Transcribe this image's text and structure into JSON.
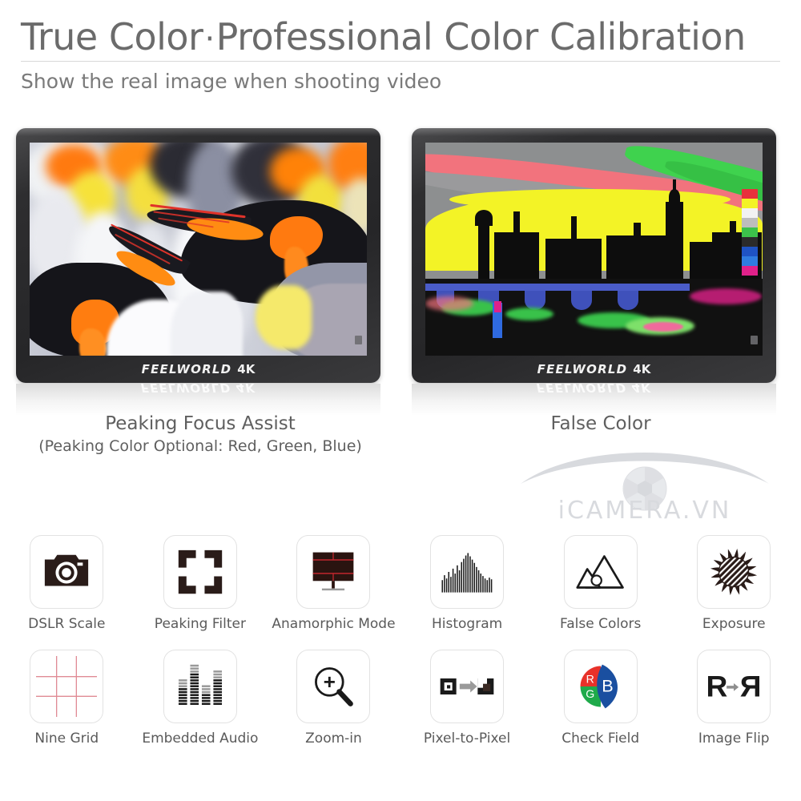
{
  "header": {
    "headline_part1": "True Color",
    "headline_separator": "·",
    "headline_part2": "Professional Color Calibration",
    "subhead": "Show the real image when shooting video"
  },
  "monitors": [
    {
      "brand": "FEELWORLD",
      "model": "4K",
      "screen_content": "king-penguins-with-red-peaking-highlights",
      "caption_title": "Peaking Focus Assist",
      "caption_note": "(Peaking Color Optional: Red, Green, Blue)"
    },
    {
      "brand": "FEELWORLD",
      "model": "4K",
      "screen_content": "westminster-big-ben-false-color",
      "caption_title": "False Color",
      "caption_note": ""
    }
  ],
  "false_color_scale": [
    "#e8313c",
    "#f3f326",
    "#f2f2f2",
    "#bdbdbd",
    "#3cc14b",
    "#2b2b2b",
    "#1f53c4",
    "#2f7ce0",
    "#e0218a"
  ],
  "watermark": {
    "text": "iCAMERA.VN",
    "icon": "aperture-icon",
    "color": "#b9bcc4"
  },
  "features": {
    "rows": [
      [
        {
          "icon": "dslr-camera-icon",
          "label": "DSLR Scale"
        },
        {
          "icon": "focus-brackets-icon",
          "label": "Peaking Filter"
        },
        {
          "icon": "monitor-guides-icon",
          "label": "Anamorphic Mode"
        },
        {
          "icon": "histogram-icon",
          "label": "Histogram"
        },
        {
          "icon": "mountains-icon",
          "label": "False Colors"
        },
        {
          "icon": "sun-icon",
          "label": "Exposure"
        }
      ],
      [
        {
          "icon": "grid-icon",
          "label": "Nine Grid"
        },
        {
          "icon": "audio-levels-icon",
          "label": "Embedded Audio"
        },
        {
          "icon": "magnifier-plus-icon",
          "label": "Zoom-in"
        },
        {
          "icon": "pixel-map-icon",
          "label": "Pixel-to-Pixel"
        },
        {
          "icon": "rgb-pie-icon",
          "label": "Check Field"
        },
        {
          "icon": "mirror-r-icon",
          "label": "Image Flip"
        }
      ]
    ]
  },
  "colors": {
    "text": "#5a5a5a",
    "headline": "#6b6b6b",
    "icon_dark": "#2a1c19",
    "accent_red": "#c0272d",
    "rgb_red": "#e8312a",
    "rgb_green": "#1faa4b",
    "rgb_blue": "#1a4fa0"
  },
  "histogram_bars": [
    30,
    42,
    34,
    50,
    38,
    58,
    46,
    66,
    54,
    74,
    82,
    90,
    96,
    88,
    80,
    72,
    62,
    54,
    46,
    40,
    34,
    30,
    36,
    32
  ],
  "audio_levels": [
    9,
    14,
    7,
    12
  ]
}
